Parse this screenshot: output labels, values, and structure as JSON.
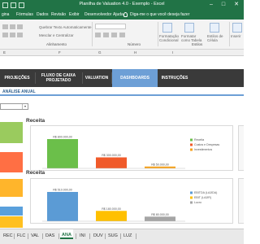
{
  "window": {
    "title": "Planilha de Valuation 4.0 - Exemplo  -  Excel",
    "controls": [
      "–",
      "□",
      "✕"
    ]
  },
  "menu": {
    "items": [
      "gina",
      "Fórmulas",
      "Dados",
      "Revisão",
      "Exibir",
      "Desenvolvedor",
      "Ajuda"
    ],
    "tell_me": "Diga-me o que você deseja fazer"
  },
  "ribbon": {
    "wrap_text": "Quebrar Texto Automaticamente",
    "merge_center": "Mesclar e Centralizar",
    "conditional_format": "Formatação Condicional",
    "format_as_table": "Formatar como Tabela",
    "cell_styles": "Estilos de Célula",
    "insert": "Inserir",
    "group_alignment": "Alinhamento",
    "group_number": "Número",
    "group_styles": "Estilos"
  },
  "columns": [
    "E",
    "F",
    "G",
    "H",
    "I"
  ],
  "nav": {
    "items": [
      {
        "label": "PROJEÇÕES"
      },
      {
        "label": "FLUXO DE CAIXA PROJETADO"
      },
      {
        "label": "VALUATION"
      },
      {
        "label": "DASHBOARDS"
      },
      {
        "label": "INSTRUÇÕES"
      }
    ],
    "active": "DASHBOARDS"
  },
  "subtab": {
    "label": "ANÁLISE ANUAL"
  },
  "dropdown": {
    "value": ""
  },
  "tiles": [
    {
      "color": "#9acb5e"
    },
    {
      "color": "#ff6f44"
    },
    {
      "color": "#ffb52b"
    },
    {
      "color": "#5aa0dc"
    },
    {
      "color": "#ffc020"
    }
  ],
  "chart_data": [
    {
      "type": "bar",
      "title": "Receita",
      "categories": [
        "Receita",
        "Custos e Despesas",
        "Investimentos"
      ],
      "values": [
        800000,
        300000,
        50000
      ],
      "value_labels": [
        "R$ 800.000,00",
        "R$ 300.000,00",
        "R$ 50.000,00"
      ],
      "colors": [
        "#6bbf4a",
        "#f05a2a",
        "#f7a21b"
      ],
      "ylim": [
        0,
        800000
      ],
      "legend": [
        "Receita",
        "Custos e Despesas",
        "Investimentos"
      ],
      "legend_position": "right"
    },
    {
      "type": "bar",
      "title": "Receita",
      "categories": [
        "EBITDA (LAJIDA)",
        "EBIT (LAJIR)",
        "Lucro"
      ],
      "values": [
        510000,
        180000,
        80000
      ],
      "value_labels": [
        "R$ 510.000,00",
        "R$ 180.000,00",
        "R$ 80.000,00"
      ],
      "colors": [
        "#5b9bd5",
        "#ffc000",
        "#a5a5a5"
      ],
      "ylim": [
        0,
        510000
      ],
      "legend": [
        "EBITDA (LAJIDA)",
        "EBIT (LAJIR)",
        "Lucro"
      ],
      "legend_position": "right"
    }
  ],
  "sheets": {
    "tabs": [
      "REC",
      "FLC",
      "VAL",
      "DAS",
      "ANA",
      "INI",
      "DUV",
      "SUG",
      "LUZ"
    ],
    "active": "ANA"
  }
}
